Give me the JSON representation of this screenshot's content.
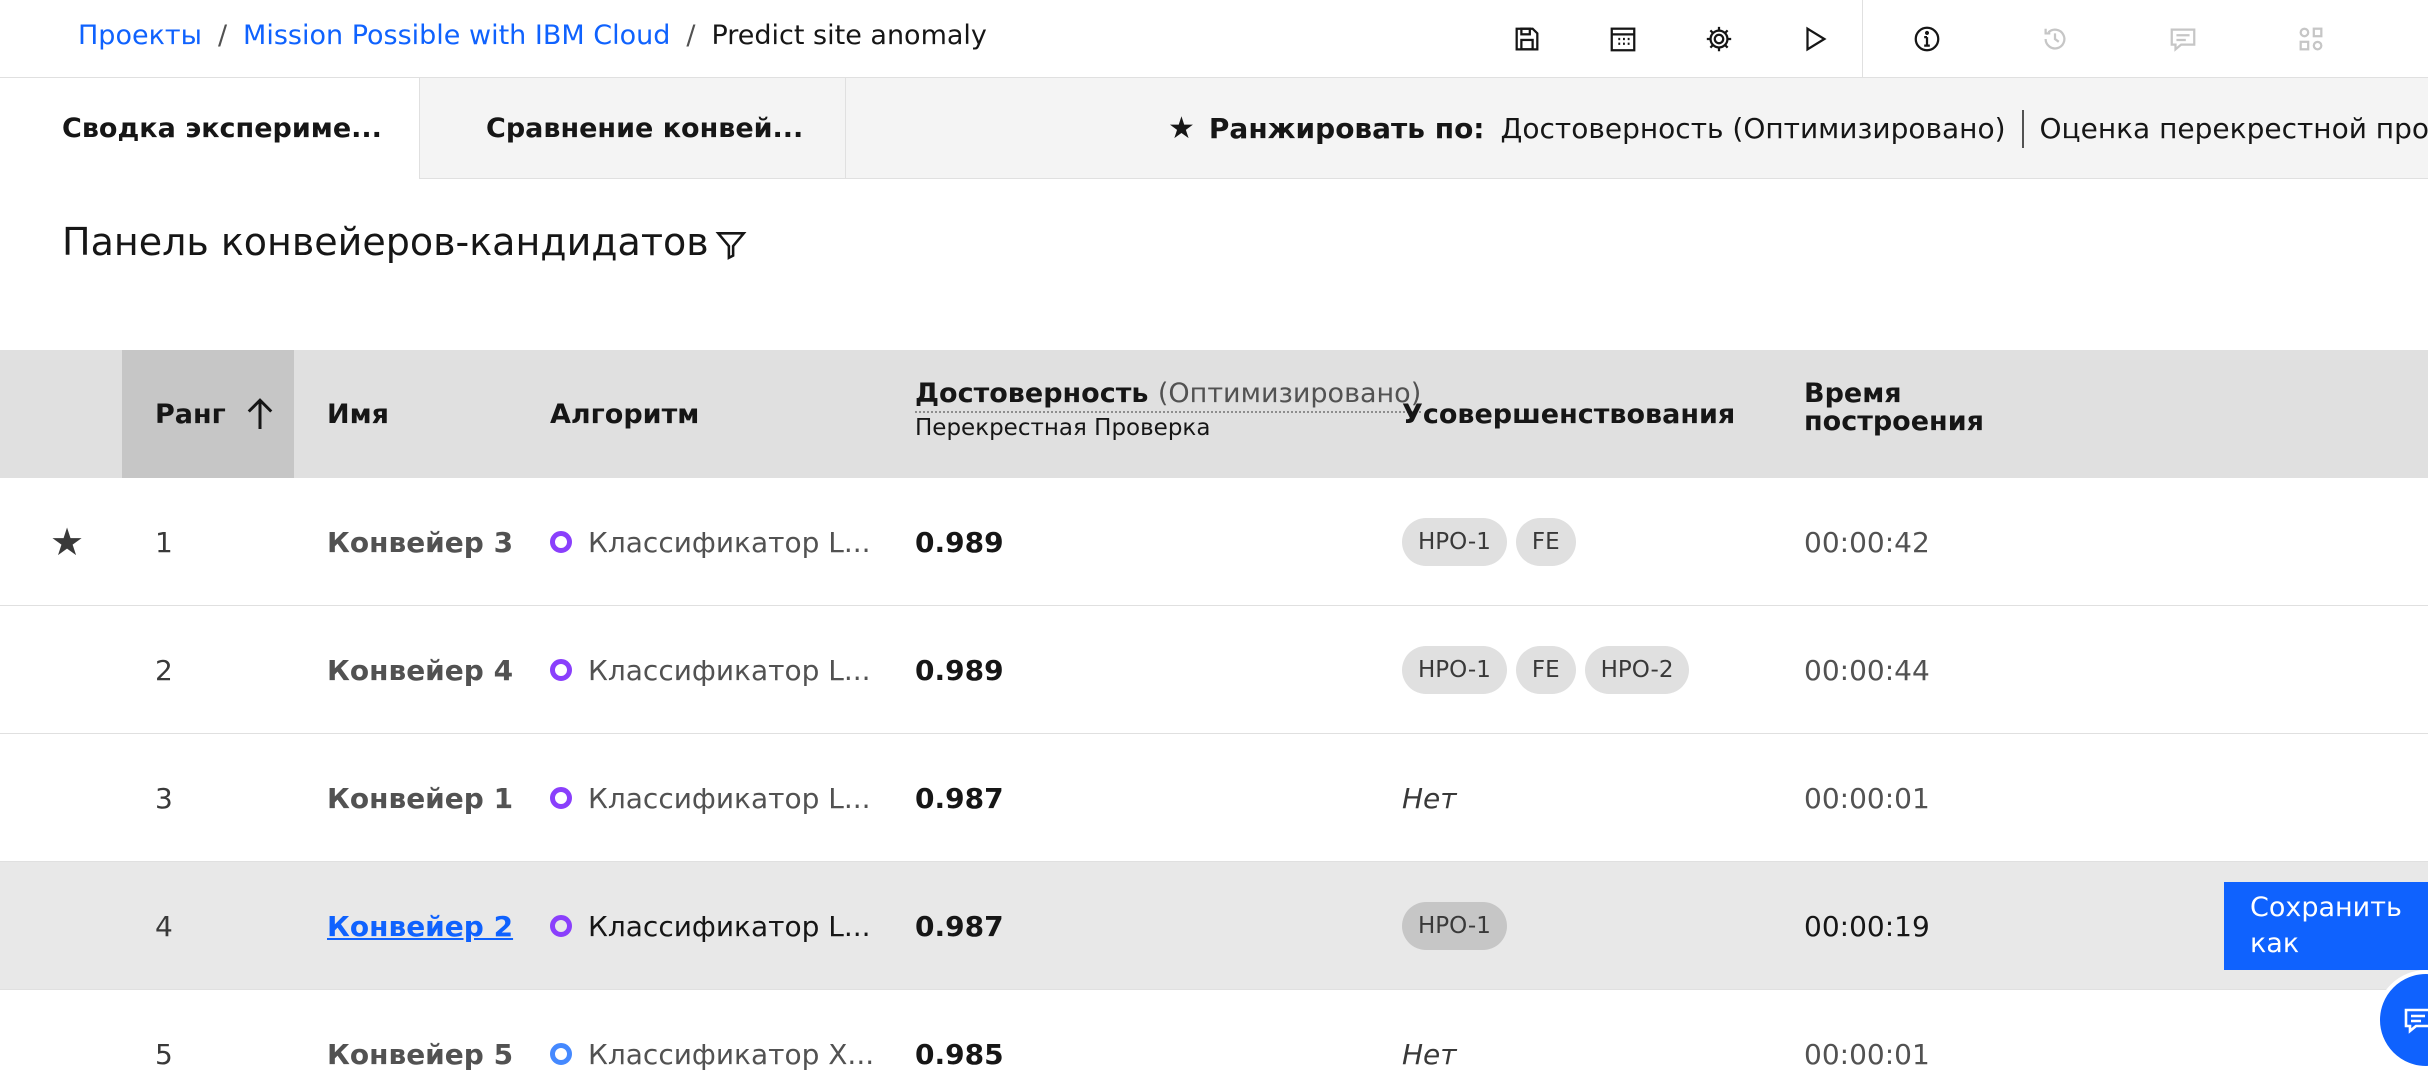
{
  "breadcrumb": {
    "projects": "Проекты",
    "sep1": "/",
    "project": "Mission Possible with IBM Cloud",
    "sep2": "/",
    "current": "Predict site anomaly"
  },
  "toolbar": {
    "icons": [
      "save-icon",
      "calendar-icon",
      "gear-icon",
      "play-icon",
      "info-icon",
      "history-icon",
      "comment-icon",
      "apps-icon"
    ]
  },
  "tabs": {
    "summary": "Сводка экспериме...",
    "compare": "Сравнение конвей..."
  },
  "rank_by": {
    "label": "Ранжировать по:",
    "star": "★",
    "metric": "Достоверность (Оптимизировано)",
    "secondary": "Оценка перекрестной проверки"
  },
  "panel": {
    "title": "Панель конвейеров-кандидатов"
  },
  "table": {
    "headers": {
      "rank": "Ранг",
      "name": "Имя",
      "algorithm": "Алгоритм",
      "accuracy": "Достоверность",
      "accuracy_note": "(Оптимизировано)",
      "accuracy_sub": "Перекрестная Проверка",
      "enhancements": "Усовершенствования",
      "build_time_1": "Время",
      "build_time_2": "построения"
    },
    "rows": [
      {
        "star": "★",
        "rank": "1",
        "name": "Конвейер 3",
        "algorithm": "Классификатор L...",
        "accuracy": "0.989",
        "tags": [
          "HPO-1",
          "FE"
        ],
        "none": "",
        "time": "00:00:42"
      },
      {
        "star": "",
        "rank": "2",
        "name": "Конвейер 4",
        "algorithm": "Классификатор L...",
        "accuracy": "0.989",
        "tags": [
          "HPO-1",
          "FE",
          "HPO-2"
        ],
        "none": "",
        "time": "00:00:44"
      },
      {
        "star": "",
        "rank": "3",
        "name": "Конвейер 1",
        "algorithm": "Классификатор L...",
        "accuracy": "0.987",
        "tags": [],
        "none": "Нет",
        "time": "00:00:01"
      },
      {
        "star": "",
        "rank": "4",
        "name": "Конвейер 2",
        "algorithm": "Классификатор L...",
        "accuracy": "0.987",
        "tags": [
          "HPO-1"
        ],
        "none": "",
        "time": "00:00:19"
      },
      {
        "star": "",
        "rank": "5",
        "name": "Конвейер 5",
        "algorithm": "Классификатор X...",
        "accuracy": "0.985",
        "tags": [],
        "none": "Нет",
        "time": "00:00:01"
      }
    ]
  },
  "actions": {
    "save_as": "Сохранить как"
  },
  "colors": {
    "accent": "#0f62fe",
    "algo_purple": "#8a3ffc",
    "algo_blue": "#4589ff"
  }
}
